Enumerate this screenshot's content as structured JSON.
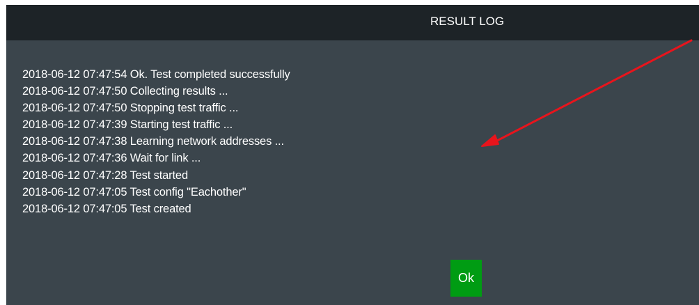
{
  "dialog": {
    "title": "RESULT LOG",
    "log_lines": [
      "2018-06-12 07:47:54 Ok. Test completed successfully",
      "2018-06-12 07:47:50 Collecting results ...",
      "2018-06-12 07:47:50 Stopping test traffic ...",
      "2018-06-12 07:47:39 Starting test traffic ...",
      "2018-06-12 07:47:38 Learning network addresses ...",
      "2018-06-12 07:47:36 Wait for link ...",
      "2018-06-12 07:47:28 Test started",
      "2018-06-12 07:47:05 Test config \"Eachother\"",
      "2018-06-12 07:47:05 Test created"
    ],
    "ok_label": "Ok"
  },
  "colors": {
    "dialog_background": "#3b454c",
    "titlebar_background": "#1d2327",
    "ok_button": "#009c13",
    "annotation_arrow": "#e8141c"
  }
}
